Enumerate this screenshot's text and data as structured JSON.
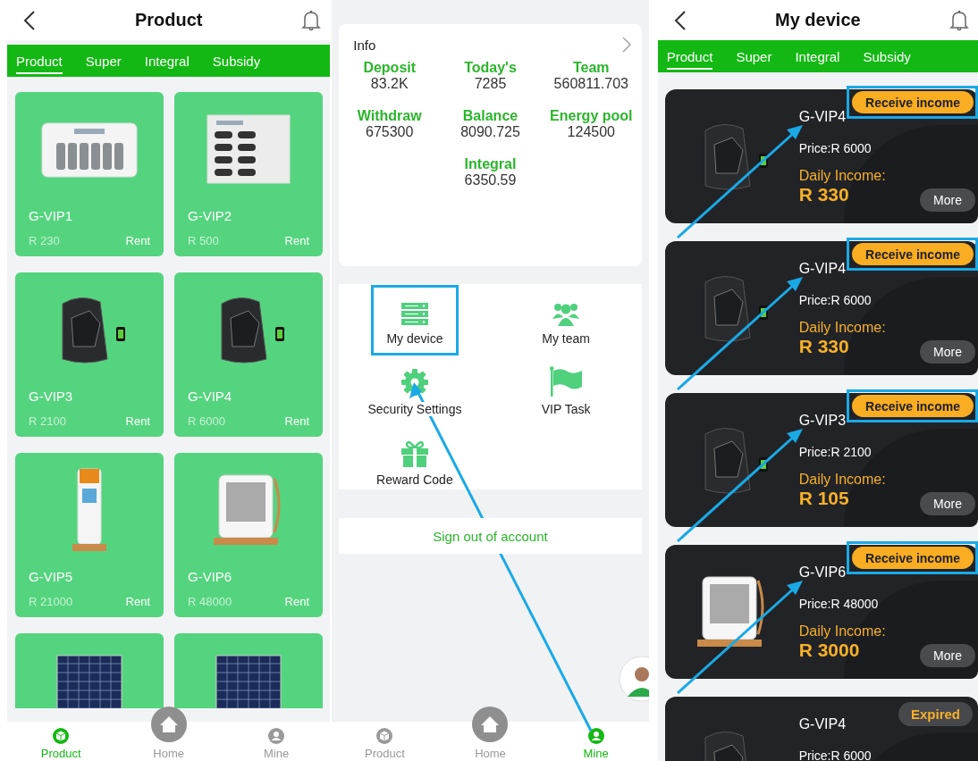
{
  "product_screen": {
    "title": "Product",
    "tabs": [
      {
        "label": "Product",
        "selected": true
      },
      {
        "label": "Super",
        "selected": false
      },
      {
        "label": "Integral",
        "selected": false
      },
      {
        "label": "Subsidy",
        "selected": false
      }
    ],
    "products": [
      {
        "kind": "hub",
        "name": "G-VIP1",
        "price": "R 230",
        "action": "Rent"
      },
      {
        "kind": "locker",
        "name": "G-VIP2",
        "price": "R 500",
        "action": "Rent"
      },
      {
        "kind": "backpack",
        "name": "G-VIP3",
        "price": "R 2100",
        "action": "Rent"
      },
      {
        "kind": "backpack",
        "name": "G-VIP4",
        "price": "R 6000",
        "action": "Rent"
      },
      {
        "kind": "pillar",
        "name": "G-VIP5",
        "price": "R 21000",
        "action": "Rent"
      },
      {
        "kind": "cabinet",
        "name": "G-VIP6",
        "price": "R 48000",
        "action": "Rent"
      },
      {
        "kind": "solar"
      },
      {
        "kind": "solar"
      }
    ],
    "nav": [
      {
        "kind": "product",
        "label": "Product",
        "selected": true
      },
      {
        "kind": "home",
        "label": "Home",
        "selected": false
      },
      {
        "kind": "mine",
        "label": "Mine",
        "selected": false
      }
    ]
  },
  "mine_screen": {
    "info": {
      "title": "Info",
      "stats": [
        {
          "label": "Deposit",
          "value": "83.2K"
        },
        {
          "label": "Today's",
          "value": "7285"
        },
        {
          "label": "Team",
          "value": "560811.703"
        },
        {
          "label": "Withdraw",
          "value": "675300"
        },
        {
          "label": "Balance",
          "value": "8090.725"
        },
        {
          "label": "Energy pool",
          "value": "124500"
        },
        {
          "label": "Integral",
          "value": "6350.59"
        }
      ]
    },
    "menu": [
      {
        "kind": "server",
        "label": "My device",
        "highlighted": true
      },
      {
        "kind": "team",
        "label": "My team",
        "highlighted": false
      },
      {
        "kind": "gear",
        "label": "Security Settings",
        "highlighted": false
      },
      {
        "kind": "flag",
        "label": "VIP Task",
        "highlighted": false
      },
      {
        "kind": "gift",
        "label": "Reward Code",
        "highlighted": false
      }
    ],
    "sign_out": "Sign out of account",
    "nav": [
      {
        "kind": "product",
        "label": "Product",
        "selected": false
      },
      {
        "kind": "home",
        "label": "Home",
        "selected": false
      },
      {
        "kind": "mine",
        "label": "Mine",
        "selected": true
      }
    ]
  },
  "device_screen": {
    "title": "My device",
    "tabs": [
      {
        "label": "Product",
        "selected": true
      },
      {
        "label": "Super",
        "selected": false
      },
      {
        "label": "Integral",
        "selected": false
      },
      {
        "label": "Subsidy",
        "selected": false
      }
    ],
    "devices": [
      {
        "kind": "backpack",
        "name": "G-VIP4",
        "price": "Price:R 6000",
        "income_label": "Daily Income:",
        "income": "R 330",
        "action": {
          "kind": "receive",
          "label": "Receive income"
        },
        "more": "More",
        "highlighted": true
      },
      {
        "kind": "backpack",
        "name": "G-VIP4",
        "price": "Price:R 6000",
        "income_label": "Daily Income:",
        "income": "R 330",
        "action": {
          "kind": "receive",
          "label": "Receive income"
        },
        "more": "More",
        "highlighted": true
      },
      {
        "kind": "backpack",
        "name": "G-VIP3",
        "price": "Price:R 2100",
        "income_label": "Daily Income:",
        "income": "R 105",
        "action": {
          "kind": "receive",
          "label": "Receive income"
        },
        "more": "More",
        "highlighted": true
      },
      {
        "kind": "cabinet",
        "name": "G-VIP6",
        "price": "Price:R 48000",
        "income_label": "Daily Income:",
        "income": "R 3000",
        "action": {
          "kind": "receive",
          "label": "Receive income"
        },
        "more": "More",
        "highlighted": true
      },
      {
        "kind": "backpack",
        "name": "G-VIP4",
        "price": "Price:R 6000",
        "action": {
          "kind": "expired",
          "label": "Expired"
        },
        "highlighted": false
      }
    ]
  }
}
